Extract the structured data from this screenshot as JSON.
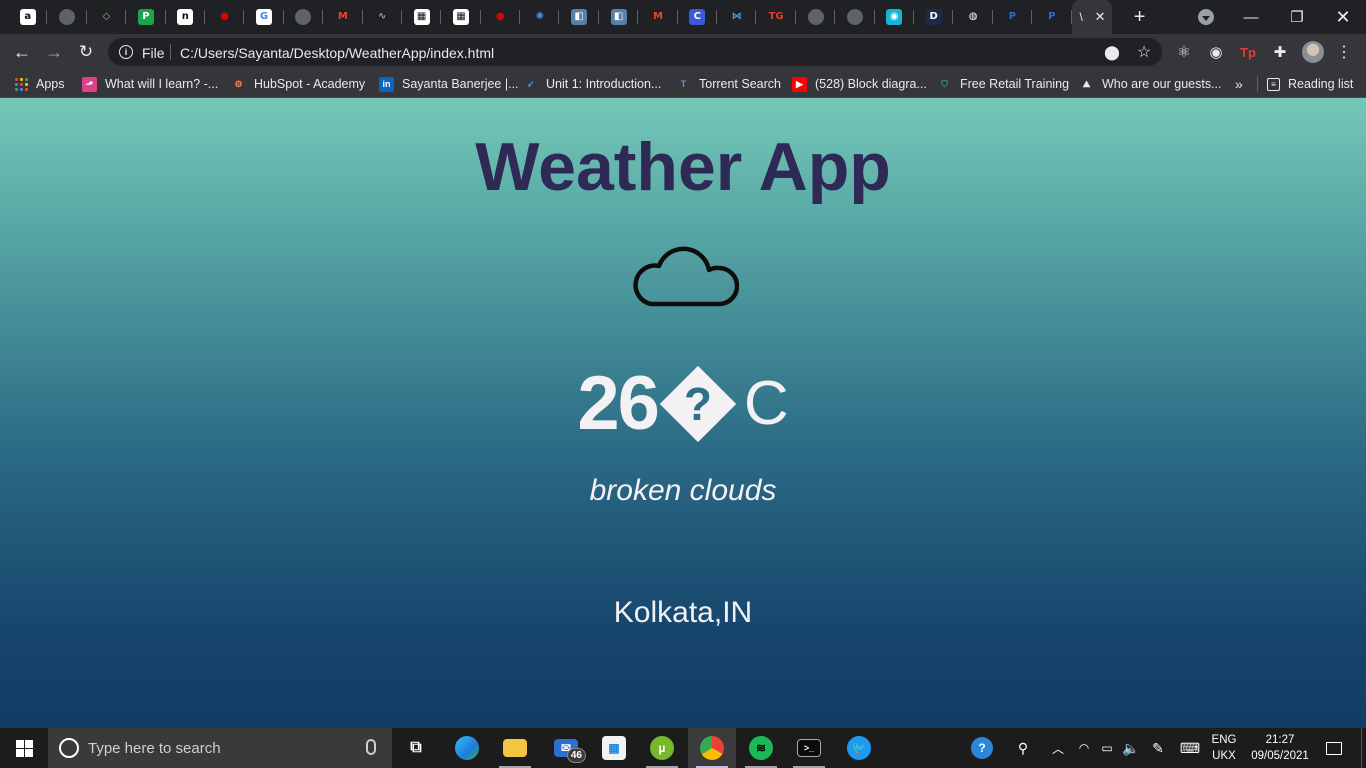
{
  "browser": {
    "tabs": [
      {
        "name": "amazon",
        "glyph": "a",
        "bg": "#ffffff",
        "fg": "#111111"
      },
      {
        "name": "generic-1",
        "glyph": "",
        "bg": "#5f6368",
        "fg": "#ffffff"
      },
      {
        "name": "diamond",
        "glyph": "◇",
        "bg": "#202124",
        "fg": "#8bc34a"
      },
      {
        "name": "p-green",
        "glyph": "P",
        "bg": "#1ea44b",
        "fg": "#ffffff"
      },
      {
        "name": "notion",
        "glyph": "n",
        "bg": "#ffffff",
        "fg": "#111111"
      },
      {
        "name": "redhat-1",
        "glyph": "●",
        "bg": "#202124",
        "fg": "#e00000"
      },
      {
        "name": "google",
        "glyph": "G",
        "bg": "#ffffff",
        "fg": "#4285f4"
      },
      {
        "name": "generic-2",
        "glyph": "",
        "bg": "#5f6368",
        "fg": "#ffffff"
      },
      {
        "name": "gmail-1",
        "glyph": "M",
        "bg": "#202124",
        "fg": "#ea4335"
      },
      {
        "name": "wave",
        "glyph": "∿",
        "bg": "#202124",
        "fg": "#9aa0a6"
      },
      {
        "name": "pattern-1",
        "glyph": "▦",
        "bg": "#ffffff",
        "fg": "#111111"
      },
      {
        "name": "pattern-2",
        "glyph": "▦",
        "bg": "#ffffff",
        "fg": "#111111"
      },
      {
        "name": "redhat-2",
        "glyph": "●",
        "bg": "#202124",
        "fg": "#e00000"
      },
      {
        "name": "spinner",
        "glyph": "✺",
        "bg": "#202124",
        "fg": "#4a90e2"
      },
      {
        "name": "box-1",
        "glyph": "◧",
        "bg": "#5a7fa8",
        "fg": "#ffffff"
      },
      {
        "name": "box-2",
        "glyph": "◧",
        "bg": "#5a7fa8",
        "fg": "#ffffff"
      },
      {
        "name": "gmail-2",
        "glyph": "M",
        "bg": "#202124",
        "fg": "#ea4335"
      },
      {
        "name": "c-circle",
        "glyph": "C",
        "bg": "#3a5bd9",
        "fg": "#ffffff"
      },
      {
        "name": "bowtie",
        "glyph": "⋈",
        "bg": "#202124",
        "fg": "#4aa3df"
      },
      {
        "name": "tg",
        "glyph": "TG",
        "bg": "#202124",
        "fg": "#e53935"
      },
      {
        "name": "generic-3",
        "glyph": "",
        "bg": "#5f6368",
        "fg": "#ffffff"
      },
      {
        "name": "generic-4",
        "glyph": "",
        "bg": "#5f6368",
        "fg": "#ffffff"
      },
      {
        "name": "cyan-circle",
        "glyph": "◉",
        "bg": "#1ab3d6",
        "fg": "#ffffff"
      },
      {
        "name": "d-letter",
        "glyph": "D",
        "bg": "#1e2a4a",
        "fg": "#ffffff"
      },
      {
        "name": "github",
        "glyph": "◍",
        "bg": "#202124",
        "fg": "#ffffff"
      },
      {
        "name": "paypal-1",
        "glyph": "P",
        "bg": "#202124",
        "fg": "#2b6cd9"
      },
      {
        "name": "paypal-2",
        "glyph": "P",
        "bg": "#202124",
        "fg": "#2b6cd9"
      }
    ],
    "active_tab_title": "\\",
    "address": {
      "scheme_label": "File",
      "url": "C:/Users/Sayanta/Desktop/WeatherApp/index.html"
    },
    "bookmarks": [
      {
        "name": "what-will-i-learn",
        "label": "What will I learn? -...",
        "icon_bg": "#e0408a",
        "glyph": "⬏"
      },
      {
        "name": "hubspot",
        "label": "HubSpot - Academy",
        "icon_bg": "#35363a",
        "glyph": "⚙",
        "icon_fg": "#ff7a59"
      },
      {
        "name": "linkedin",
        "label": "Sayanta Banerjee |...",
        "icon_bg": "#0a66c2",
        "glyph": "in"
      },
      {
        "name": "sap",
        "label": "Unit 1: Introduction...",
        "icon_bg": "#35363a",
        "glyph": "➶",
        "icon_fg": "#3e8ede"
      },
      {
        "name": "torrent",
        "label": "Torrent Search",
        "icon_bg": "#35363a",
        "glyph": "T",
        "icon_fg": "#6b8dd6"
      },
      {
        "name": "youtube",
        "label": "(528) Block diagra...",
        "icon_bg": "#ff0000",
        "glyph": "▶"
      },
      {
        "name": "retail",
        "label": "Free Retail Training",
        "icon_bg": "#35363a",
        "glyph": "⛉",
        "icon_fg": "#2ea36b"
      },
      {
        "name": "guests",
        "label": "Who are our guests...",
        "icon_bg": "#35363a",
        "glyph": "⛰",
        "icon_fg": "#e8eaed"
      }
    ],
    "apps_label": "Apps",
    "overflow_label": "»",
    "reading_list_label": "Reading list"
  },
  "page": {
    "title": "Weather App",
    "weather_icon": "cloud-icon",
    "temperature_value": "26",
    "temperature_unknown_glyph": "?",
    "temperature_unit": "C",
    "description": "broken clouds",
    "location": "Kolkata,IN",
    "title_color": "#2e2a55"
  },
  "taskbar": {
    "search_placeholder": "Type here to search",
    "mail_badge": "46",
    "language_line1": "ENG",
    "language_line2": "UKX",
    "time": "21:27",
    "date": "09/05/2021"
  }
}
